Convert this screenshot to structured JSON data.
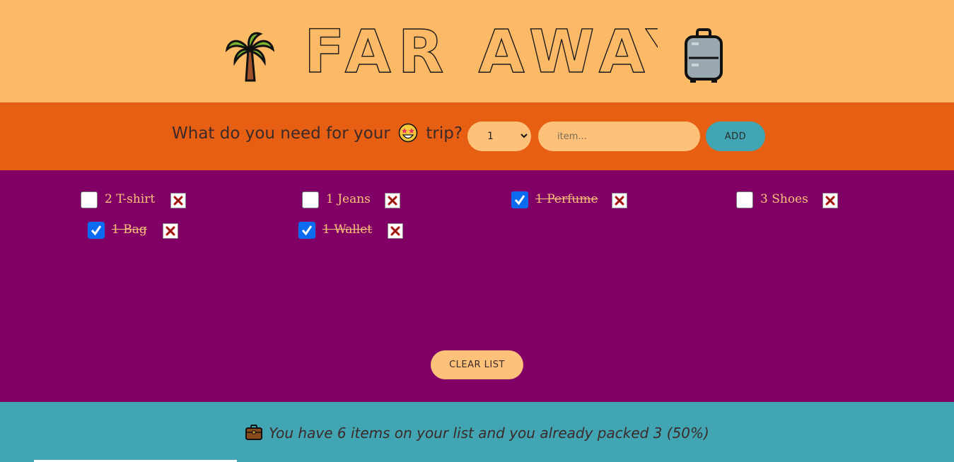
{
  "header": {
    "title": "FAR AWAY",
    "left_icon": "palm-tree-icon",
    "right_icon": "luggage-icon"
  },
  "form": {
    "question_before": "What do you need for your",
    "question_emoji": "star-struck-face-icon",
    "question_after": "trip?",
    "quantity_value": "1",
    "item_placeholder": "item...",
    "add_label": "ADD"
  },
  "items": [
    {
      "quantity": 2,
      "description": "T-shirt",
      "packed": false,
      "label": "2 T-shirt"
    },
    {
      "quantity": 1,
      "description": "Jeans",
      "packed": false,
      "label": "1 Jeans"
    },
    {
      "quantity": 1,
      "description": "Perfume",
      "packed": true,
      "label": "1 Perfume"
    },
    {
      "quantity": 3,
      "description": "Shoes",
      "packed": false,
      "label": "3 Shoes"
    },
    {
      "quantity": 1,
      "description": "Bag",
      "packed": true,
      "label": "1 Bag"
    },
    {
      "quantity": 1,
      "description": "Wallet",
      "packed": true,
      "label": "1 Wallet"
    }
  ],
  "delete_icon": "cross-mark-icon",
  "clear_label": "CLEAR LIST",
  "stats": {
    "icon": "briefcase-icon",
    "text": "You have 6 items on your list and you already packed 3 (50%)"
  },
  "colors": {
    "header_bg": "#fdba66",
    "form_bg": "#e65f12",
    "list_bg": "#800066",
    "footer_bg": "#42a5b3",
    "accent_light": "#fdc17a",
    "checkbox_checked": "#0b6cf2"
  }
}
